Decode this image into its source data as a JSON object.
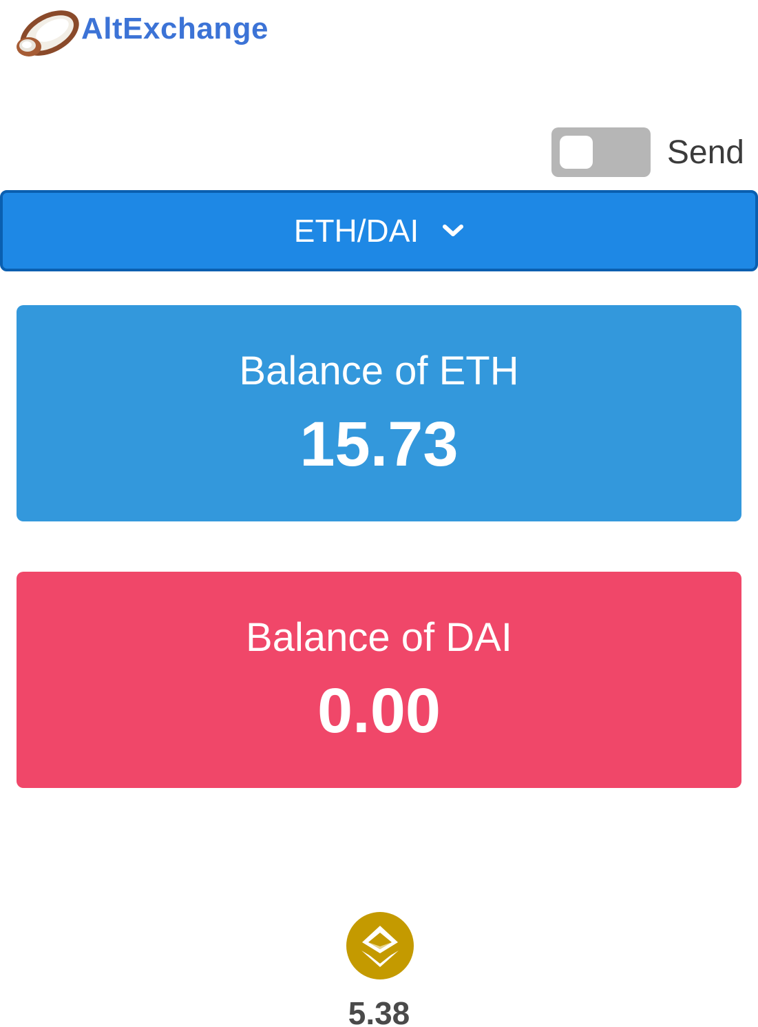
{
  "app": {
    "name": "AltExchange",
    "logo_icon": "coconut-icon",
    "brand_color": "#3c73d6"
  },
  "send_toggle": {
    "label": "Send",
    "on": false
  },
  "pair_selector": {
    "value": "ETH/DAI",
    "icon": "chevron-down-icon",
    "color": "#1e88e5"
  },
  "balances": [
    {
      "title": "Balance of ETH",
      "value": "15.73",
      "color": "#3398dc"
    },
    {
      "title": "Balance of DAI",
      "value": "0.00",
      "color": "#f04769"
    }
  ],
  "token": {
    "icon": "gold-token-icon",
    "value": "5.38"
  }
}
